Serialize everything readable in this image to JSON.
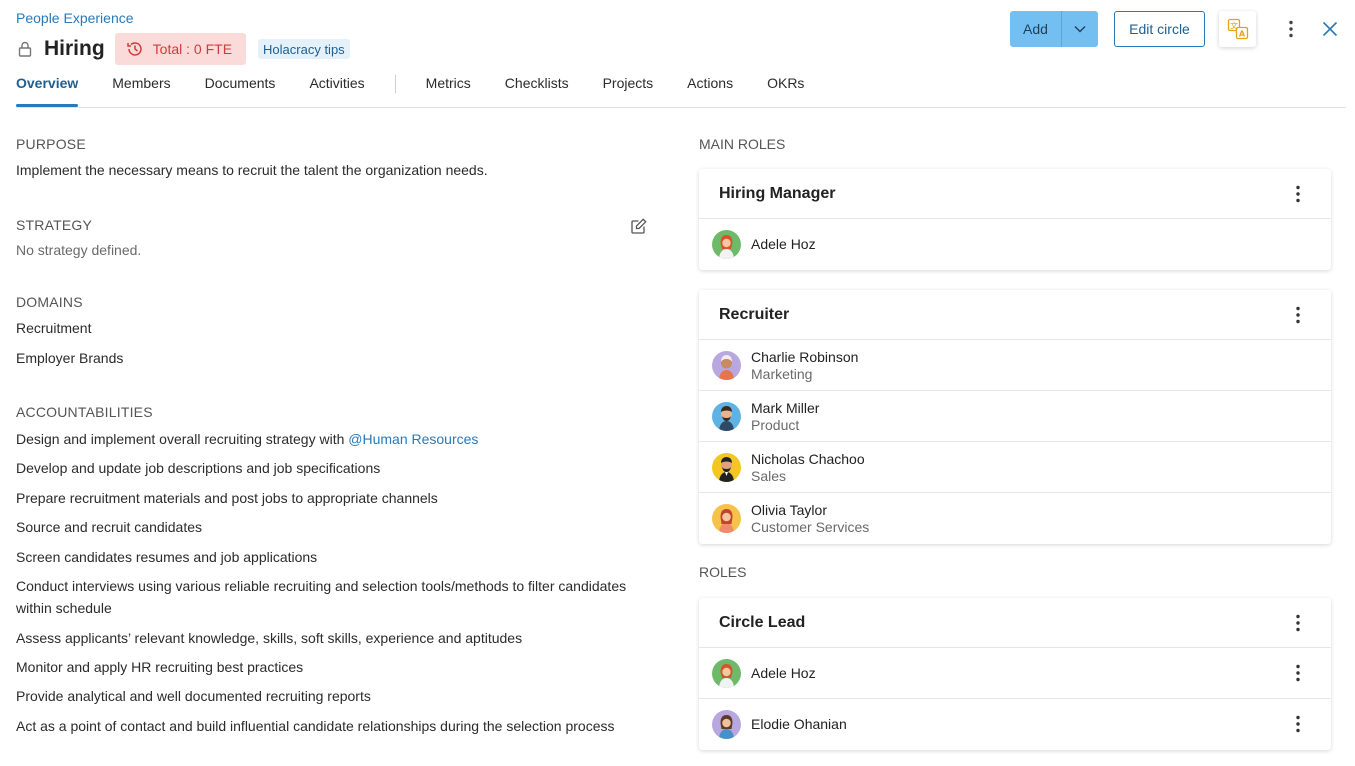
{
  "header": {
    "breadcrumb": "People Experience",
    "title": "Hiring",
    "fte_badge": "Total : 0 FTE",
    "tips_badge": "Holacracy tips",
    "add_label": "Add",
    "edit_label": "Edit circle"
  },
  "tabs": [
    {
      "label": "Overview",
      "active": true
    },
    {
      "label": "Members"
    },
    {
      "label": "Documents"
    },
    {
      "label": "Activities"
    },
    {
      "label": "Metrics"
    },
    {
      "label": "Checklists"
    },
    {
      "label": "Projects"
    },
    {
      "label": "Actions"
    },
    {
      "label": "OKRs"
    }
  ],
  "purpose": {
    "label": "PURPOSE",
    "text": "Implement the necessary means to recruit the talent the organization needs."
  },
  "strategy": {
    "label": "STRATEGY",
    "text": "No strategy defined."
  },
  "domains": {
    "label": "DOMAINS",
    "items": [
      "Recruitment",
      "Employer Brands"
    ]
  },
  "accountabilities": {
    "label": "ACCOUNTABILITIES",
    "first_prefix": "Design and implement overall recruiting strategy with ",
    "first_mention": "@Human Resources",
    "items": [
      "Develop and update job descriptions and job specifications",
      "Prepare recruitment materials and post jobs to appropriate channels",
      "Source and recruit candidates",
      "Screen candidates resumes and job applications",
      "Conduct interviews using various reliable recruiting and selection tools/methods to filter candidates within schedule",
      "Assess applicants’ relevant knowledge, skills, soft skills, experience and aptitudes",
      "Monitor and apply HR recruiting best practices",
      "Provide analytical and well documented recruiting reports",
      "Act as a point of contact and build influential candidate relationships during the selection process"
    ]
  },
  "main_roles": {
    "label": "MAIN ROLES",
    "cards": [
      {
        "title": "Hiring Manager",
        "members": [
          {
            "name": "Adele Hoz",
            "team": ""
          }
        ]
      },
      {
        "title": "Recruiter",
        "members": [
          {
            "name": "Charlie Robinson",
            "team": "Marketing"
          },
          {
            "name": "Mark Miller",
            "team": "Product"
          },
          {
            "name": "Nicholas Chachoo",
            "team": "Sales"
          },
          {
            "name": "Olivia Taylor",
            "team": "Customer Services"
          }
        ]
      }
    ]
  },
  "roles": {
    "label": "ROLES",
    "cards": [
      {
        "title": "Circle Lead",
        "members": [
          {
            "name": "Adele Hoz"
          },
          {
            "name": "Elodie Ohanian"
          }
        ]
      }
    ]
  },
  "colors": {
    "accent": "#2a79b8",
    "add_button": "#74bff2",
    "fte_badge_bg": "#fbdada",
    "fte_badge_text": "#d23a3a",
    "tips_badge_bg": "#e4f1fb"
  }
}
